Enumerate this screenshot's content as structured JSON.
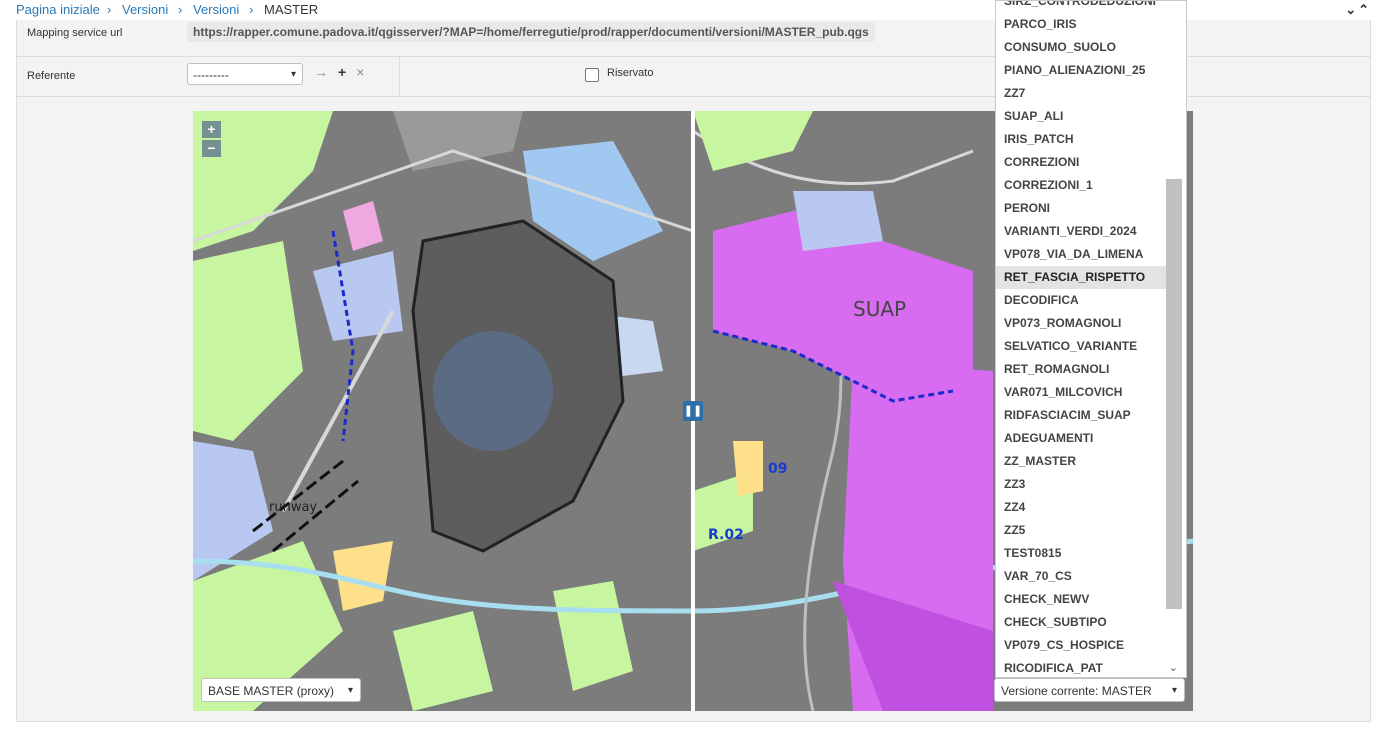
{
  "breadcrumb": {
    "home": "Pagina iniziale",
    "versions1": "Versioni",
    "versions2": "Versioni",
    "current": "MASTER"
  },
  "form": {
    "mapping_label": "Mapping service url",
    "mapping_url": "https://rapper.comune.padova.it/qgisserver/?MAP=/home/ferregutie/prod/rapper/documenti/versioni/MASTER_pub.qgs",
    "referente_label": "Referente",
    "referente_value": "---------",
    "riservato_label": "Riservato"
  },
  "map": {
    "zoom_in": "+",
    "zoom_out": "−",
    "swipe_icon": "pause-icon",
    "labels": [
      "runway",
      "SUAP",
      "09",
      "R.02"
    ],
    "base_layer": "BASE MASTER (proxy)",
    "version_select": "Versione corrente: MASTER"
  },
  "versions_list": [
    "SIRZ_CONTRODEDUZIONI",
    "PARCO_IRIS",
    "CONSUMO_SUOLO",
    "PIANO_ALIENAZIONI_25",
    "ZZ7",
    "SUAP_ALI",
    "IRIS_PATCH",
    "CORREZIONI",
    "CORREZIONI_1",
    "PERONI",
    "VARIANTI_VERDI_2024",
    "VP078_VIA_DA_LIMENA",
    "RET_FASCIA_RISPETTO",
    "DECODIFICA",
    "VP073_ROMAGNOLI",
    "SELVATICO_VARIANTE",
    "RET_ROMAGNOLI",
    "VAR071_MILCOVICH",
    "RIDFASCIACIM_SUAP",
    "ADEGUAMENTI",
    "ZZ_MASTER",
    "ZZ3",
    "ZZ4",
    "ZZ5",
    "TEST0815",
    "VAR_70_CS",
    "CHECK_NEWV",
    "CHECK_SUBTIPO",
    "VP079_CS_HOSPICE",
    "RICODIFICA_PAT"
  ],
  "selected_version": "RET_FASCIA_RISPETTO",
  "colors": {
    "link": "#2a7ab8",
    "map_base": "#7a7a7a",
    "green": "#c8f5a0",
    "purple": "#d86cf0",
    "blue": "#b8c8f0"
  }
}
